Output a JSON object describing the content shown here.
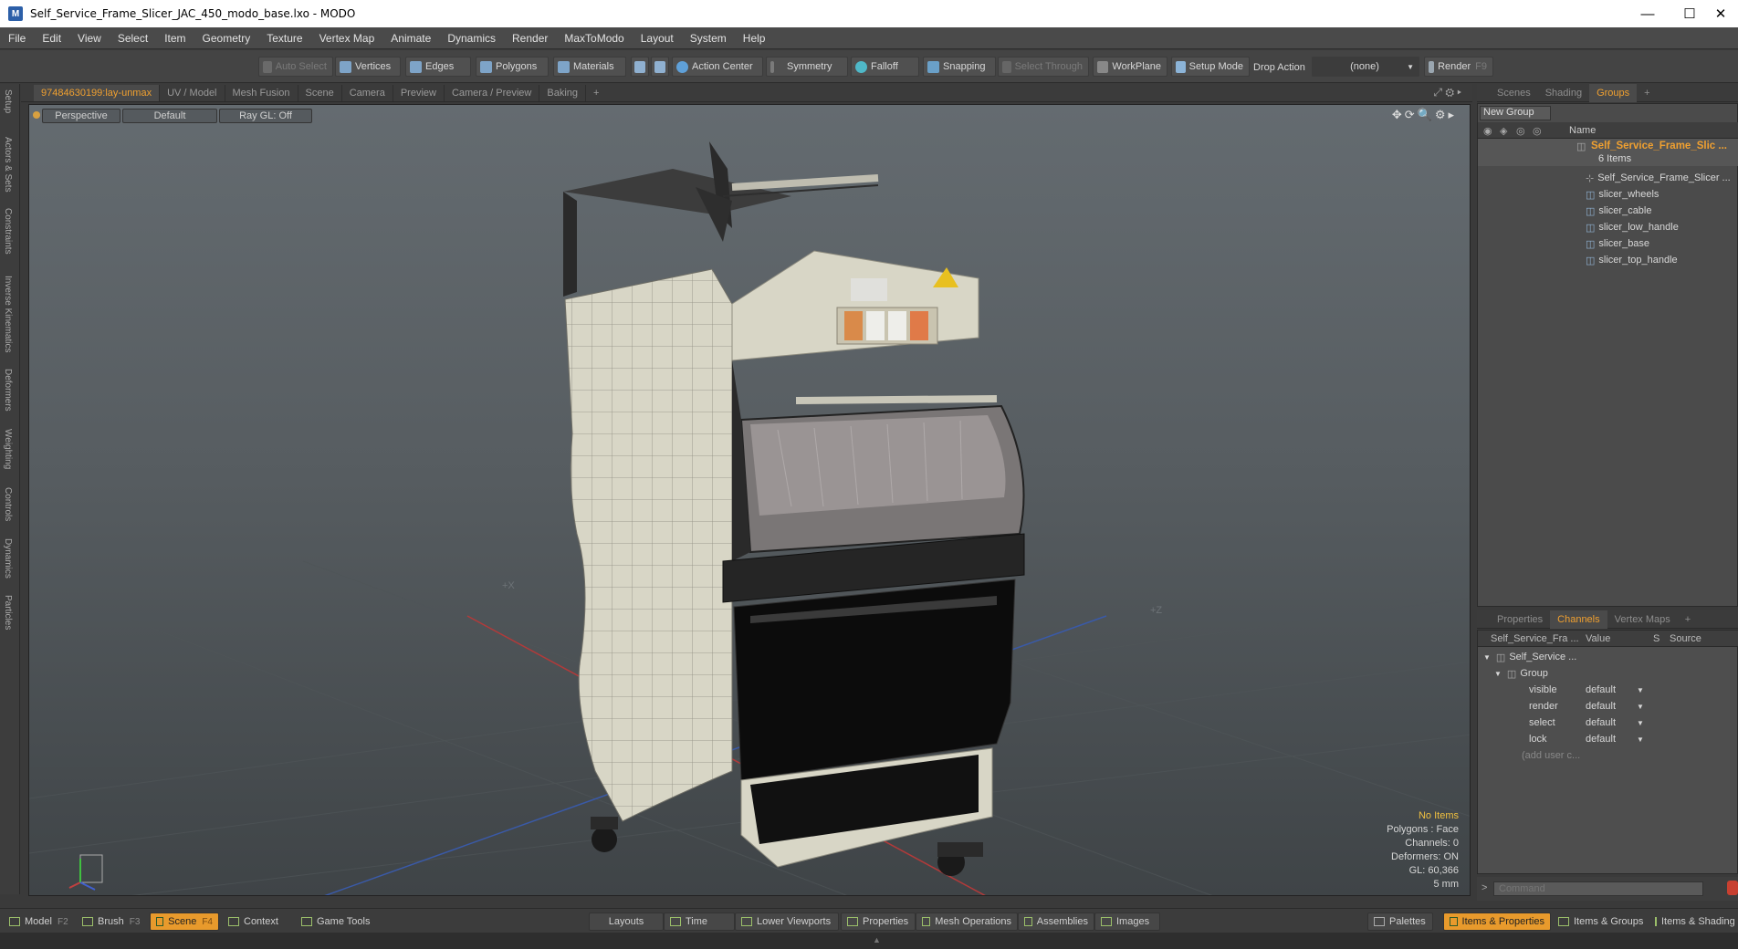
{
  "window": {
    "title": "Self_Service_Frame_Slicer_JAC_450_modo_base.lxo - MODO",
    "app_icon": "M",
    "minimize": "—",
    "maximize": "☐",
    "close": "✕"
  },
  "menu": [
    "File",
    "Edit",
    "View",
    "Select",
    "Item",
    "Geometry",
    "Texture",
    "Vertex Map",
    "Animate",
    "Dynamics",
    "Render",
    "MaxToModo",
    "Layout",
    "System",
    "Help"
  ],
  "toolbar": {
    "auto_select": "Auto Select",
    "vertices": "Vertices",
    "edges": "Edges",
    "polygons": "Polygons",
    "materials": "Materials",
    "action_center": "Action Center",
    "symmetry": "Symmetry",
    "falloff": "Falloff",
    "snapping": "Snapping",
    "select_through": "Select Through",
    "workplane": "WorkPlane",
    "setup_mode": "Setup Mode",
    "drop_action": "Drop Action",
    "drop_action_value": "(none)",
    "render": "Render",
    "render_key": "F9"
  },
  "left_tabs": [
    "Setup",
    "Actors & Sets",
    "Constraints",
    "Inverse Kinematics",
    "Deformers",
    "Weighting",
    "Controls",
    "Dynamics",
    "Particles"
  ],
  "viewport_tabs": [
    "97484630199:lay-unmax",
    "UV / Model",
    "Mesh Fusion",
    "Scene",
    "Camera",
    "Preview",
    "Camera / Preview",
    "Baking",
    "+"
  ],
  "viewport": {
    "view_mode": "Perspective",
    "shading": "Default",
    "raygl": "Ray GL: Off",
    "axis_x": "+X",
    "axis_z": "+Z",
    "info": {
      "items": "No Items",
      "polygons": "Polygons : Face",
      "channels": "Channels: 0",
      "deformers": "Deformers: ON",
      "gl": "GL: 60,366",
      "unit": "5 mm"
    }
  },
  "scene_tabs": [
    "Scenes",
    "Shading",
    "Groups",
    "+"
  ],
  "groups": {
    "new_group": "New Group",
    "name_header": "Name",
    "root": "Self_Service_Frame_Slic ...",
    "count": "6 Items",
    "children": [
      "Self_Service_Frame_Slicer ...",
      "slicer_wheels",
      "slicer_cable",
      "slicer_low_handle",
      "slicer_base",
      "slicer_top_handle"
    ]
  },
  "props_tabs": [
    "Properties",
    "Channels",
    "Vertex Maps",
    "+"
  ],
  "channels": {
    "headers": {
      "name": "Self_Service_Fra ...",
      "value": "Value",
      "s": "S",
      "source": "Source"
    },
    "root": "Self_Service ...",
    "group": "Group",
    "rows": [
      {
        "name": "visible",
        "value": "default"
      },
      {
        "name": "render",
        "value": "default"
      },
      {
        "name": "select",
        "value": "default"
      },
      {
        "name": "lock",
        "value": "default"
      }
    ],
    "add_user": "(add user c...",
    "command_placeholder": "Command"
  },
  "bottom": {
    "model": "Model",
    "model_key": "F2",
    "brush": "Brush",
    "brush_key": "F3",
    "scene": "Scene",
    "scene_key": "F4",
    "context": "Context",
    "game_tools": "Game Tools",
    "layouts": "Layouts",
    "time": "Time",
    "lower_viewports": "Lower Viewports",
    "properties": "Properties",
    "mesh_operations": "Mesh Operations",
    "assemblies": "Assemblies",
    "images": "Images",
    "palettes": "Palettes",
    "items_properties": "Items & Properties",
    "items_groups": "Items & Groups",
    "items_shading": "Items & Shading"
  },
  "colors": {
    "accent": "#f0a030",
    "viewport_top": "#646b70",
    "viewport_bottom": "#3f4447",
    "panel_bg": "#4e4e4e"
  }
}
